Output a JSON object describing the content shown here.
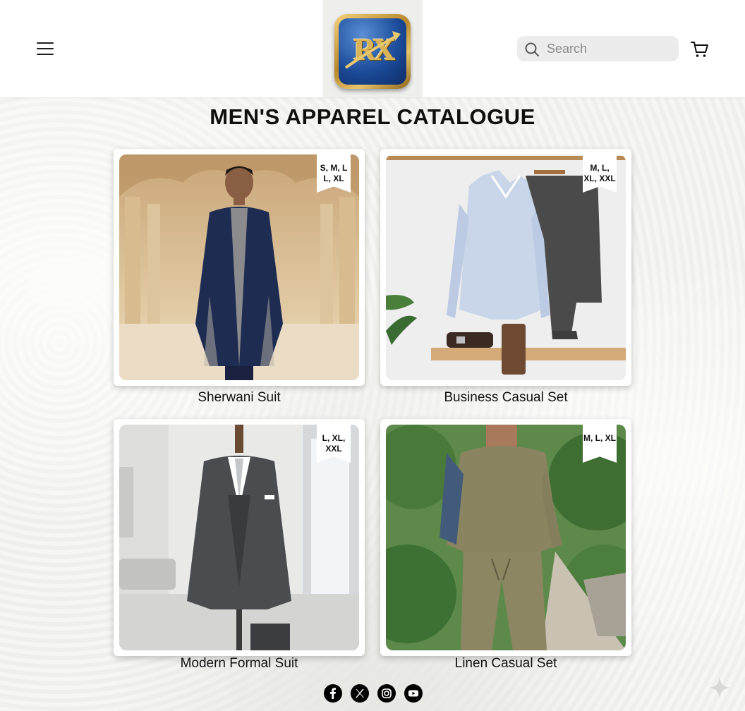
{
  "header": {
    "menu_icon": "hamburger-menu-icon",
    "logo_text": "RX",
    "search": {
      "placeholder": "Search",
      "icon": "search-icon"
    },
    "cart_icon": "shopping-cart-icon"
  },
  "main": {
    "title": "MEN'S APPAREL CATALOGUE",
    "products": [
      {
        "name": "Sherwani Suit",
        "sizes": "S, M, L L, XL"
      },
      {
        "name": "Business Casual Set",
        "sizes": "M, L, XL, XXL"
      },
      {
        "name": "Modern Formal Suit",
        "sizes": "L, XL, XXL"
      },
      {
        "name": "Linen Casual Set",
        "sizes": "M, L, XL"
      }
    ]
  },
  "footer": {
    "socials": [
      "facebook-icon",
      "x-icon",
      "instagram-icon",
      "youtube-icon"
    ]
  },
  "colors": {
    "header_bg": "#ffffff",
    "page_bg": "#f3f3f1",
    "text": "#111111",
    "search_bg": "#ececec"
  }
}
